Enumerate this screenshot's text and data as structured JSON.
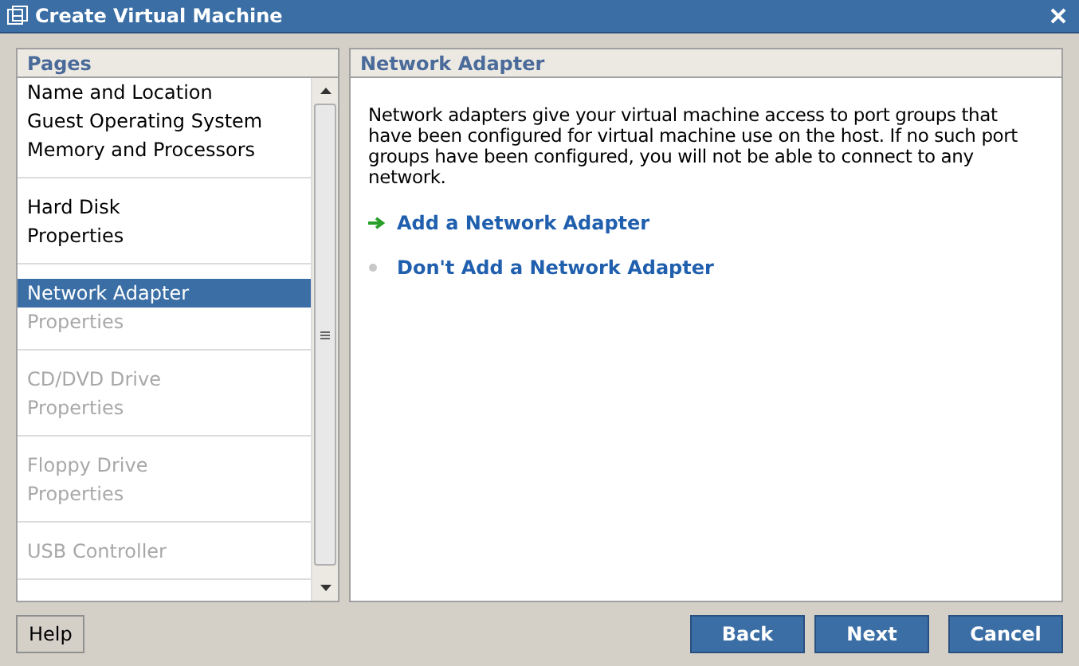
{
  "window": {
    "title": "Create Virtual Machine"
  },
  "pages": {
    "title": "Pages",
    "groups": [
      {
        "items": [
          {
            "label": "Name and Location",
            "selected": false,
            "disabled": false
          },
          {
            "label": "Guest Operating System",
            "selected": false,
            "disabled": false
          },
          {
            "label": "Memory and Processors",
            "selected": false,
            "disabled": false
          }
        ]
      },
      {
        "items": [
          {
            "label": "Hard Disk",
            "selected": false,
            "disabled": false
          },
          {
            "label": "Properties",
            "selected": false,
            "disabled": false
          }
        ]
      },
      {
        "items": [
          {
            "label": "Network Adapter",
            "selected": true,
            "disabled": false
          },
          {
            "label": "Properties",
            "selected": false,
            "disabled": true
          }
        ]
      },
      {
        "items": [
          {
            "label": "CD/DVD Drive",
            "selected": false,
            "disabled": true
          },
          {
            "label": "Properties",
            "selected": false,
            "disabled": true
          }
        ]
      },
      {
        "items": [
          {
            "label": "Floppy Drive",
            "selected": false,
            "disabled": true
          },
          {
            "label": "Properties",
            "selected": false,
            "disabled": true
          }
        ]
      },
      {
        "items": [
          {
            "label": "USB Controller",
            "selected": false,
            "disabled": true
          }
        ]
      }
    ]
  },
  "content": {
    "title": "Network Adapter",
    "description": "Network adapters give your virtual machine access to port groups that have been configured for virtual machine use on the host. If no such port groups have been configured, you will not be able to connect to any network.",
    "options": [
      {
        "label": "Add a Network Adapter",
        "kind": "arrow"
      },
      {
        "label": "Don't Add a Network Adapter",
        "kind": "dot"
      }
    ]
  },
  "buttons": {
    "help": "Help",
    "actions": [
      "Back",
      "Next",
      "Cancel"
    ]
  }
}
